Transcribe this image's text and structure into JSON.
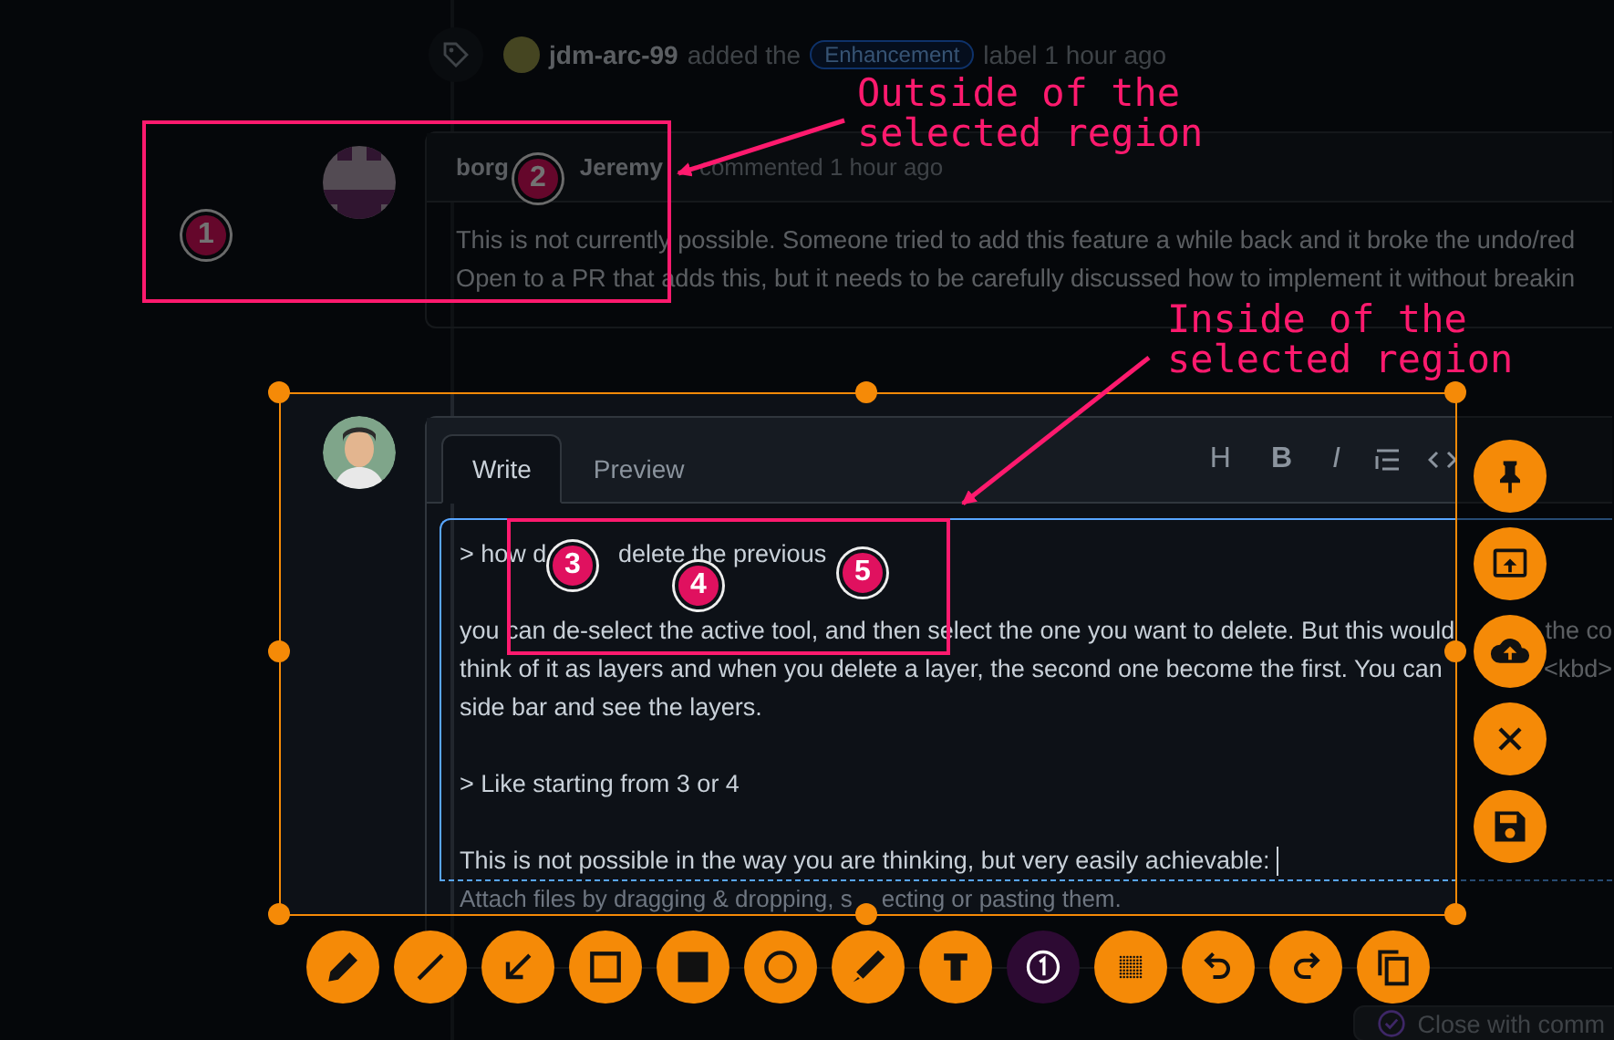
{
  "event": {
    "user": "jdm-arc-99",
    "action": "added the",
    "label": "Enhancement",
    "suffix": "label 1 hour ago"
  },
  "comment": {
    "author_start": "borg",
    "author_end": "Jeremy",
    "meta": "commented 1 hour ago",
    "lines": [
      "This is not currently possible. Someone tried to add this feature a while back and it broke the undo/red",
      "Open to a PR that adds this, but it needs to be carefully discussed how to implement it without breakin"
    ]
  },
  "editor": {
    "tabs": [
      {
        "label": "Write",
        "selected": true
      },
      {
        "label": "Preview",
        "selected": false
      }
    ],
    "format_buttons": [
      "H",
      "B",
      "I"
    ],
    "paragraphs": [
      [
        {
          "text": "> how d",
          "tail": "delete the previous"
        }
      ],
      [
        {
          "text": "you can de-select the active tool, and then select the one you want to delete. But this would",
          "tail": "the co"
        },
        {
          "text": "think of it as layers and when you delete a layer, the second one become the first. You can",
          "tail": "<kbd>"
        },
        {
          "text": "side bar and see the layers."
        }
      ],
      [
        {
          "text": "> Like starting from 3 or 4"
        }
      ],
      [
        {
          "text": "This is not possible in the way you are thinking, but very easily achievable:"
        }
      ]
    ],
    "placeholder": [
      "Attach files by dragging & dropping, s",
      "ecting or pasting them."
    ]
  },
  "close_button": "Close with comm",
  "callouts": [
    {
      "lines": [
        "Outside of the",
        "selected region"
      ]
    },
    {
      "lines": [
        "Inside of the",
        "selected region"
      ]
    }
  ],
  "markers": [
    "1",
    "2",
    "3",
    "4",
    "5"
  ],
  "tools": [
    {
      "kind": "pencil",
      "selected": false
    },
    {
      "kind": "line",
      "selected": false
    },
    {
      "kind": "arrow",
      "selected": false
    },
    {
      "kind": "rect",
      "selected": false
    },
    {
      "kind": "filled-rect",
      "selected": false
    },
    {
      "kind": "circle",
      "selected": false
    },
    {
      "kind": "marker",
      "selected": false
    },
    {
      "kind": "text",
      "selected": false
    },
    {
      "kind": "counter",
      "selected": true
    },
    {
      "kind": "blur",
      "selected": false
    },
    {
      "kind": "undo",
      "selected": false
    },
    {
      "kind": "redo",
      "selected": false
    },
    {
      "kind": "copy",
      "selected": false
    }
  ],
  "actions": [
    {
      "kind": "pin"
    },
    {
      "kind": "screen"
    },
    {
      "kind": "upload"
    },
    {
      "kind": "close"
    },
    {
      "kind": "save"
    }
  ]
}
